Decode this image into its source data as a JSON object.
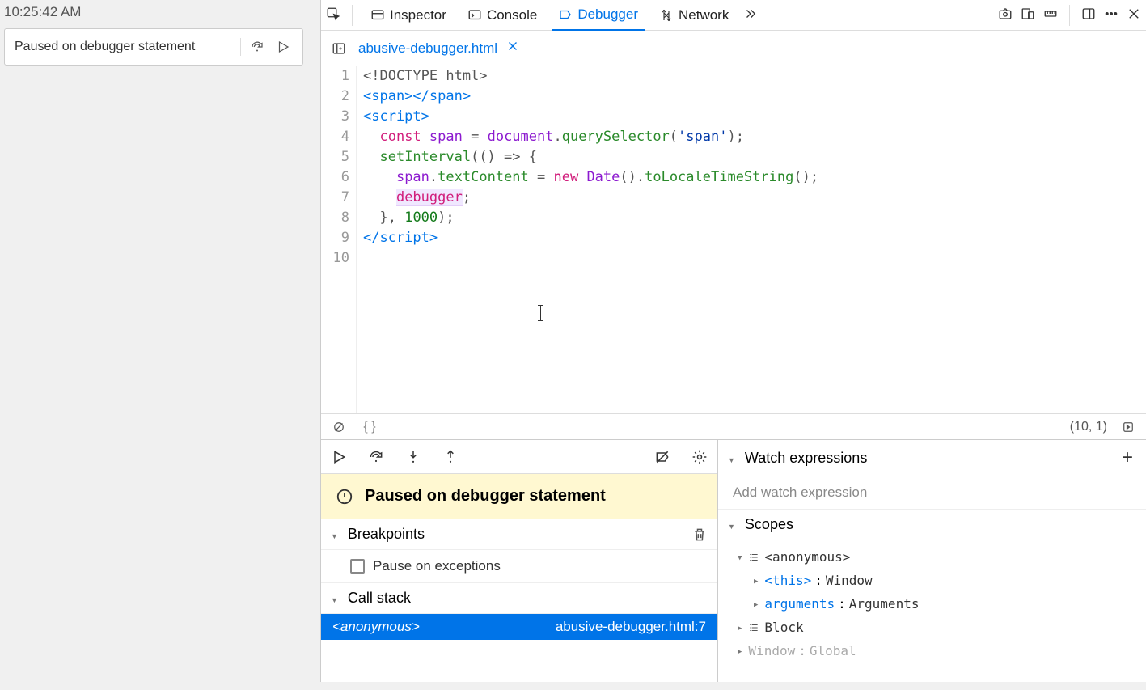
{
  "page": {
    "time": "10:25:42 AM"
  },
  "overlay": {
    "message": "Paused on debugger statement"
  },
  "toolbar": {
    "tabs": [
      {
        "label": "Inspector"
      },
      {
        "label": "Console"
      },
      {
        "label": "Debugger"
      },
      {
        "label": "Network"
      }
    ]
  },
  "file": {
    "name": "abusive-debugger.html"
  },
  "editor": {
    "lines": [
      "1",
      "2",
      "3",
      "4",
      "5",
      "6",
      "7",
      "8",
      "9",
      "10"
    ],
    "cursor": "(10, 1)"
  },
  "code": {
    "l1_doctype": "<!DOCTYPE html>",
    "l4_const": "const",
    "l4_span": "span",
    "l4_eq": " = ",
    "l4_doc": "document",
    "l4_qs": "querySelector",
    "l4_arg": "'span'",
    "l5_si": "setInterval",
    "l5_arrow": "(() => {",
    "l6_span": "span",
    "l6_tc": "textContent",
    "l6_eq": " = ",
    "l6_new": "new",
    "l6_date": "Date",
    "l6_lts": "toLocaleTimeString",
    "l7_dbg": "debugger",
    "l8_close": "}, ",
    "l8_num": "1000",
    "l8_end": ");"
  },
  "banner": {
    "text": "Paused on debugger statement"
  },
  "sections": {
    "breakpoints": "Breakpoints",
    "pauseOnExceptions": "Pause on exceptions",
    "callstack": "Call stack",
    "watch": "Watch expressions",
    "watchPlaceholder": "Add watch expression",
    "scopes": "Scopes"
  },
  "callstack": {
    "frame": "<anonymous>",
    "location": "abusive-debugger.html:7"
  },
  "scopes": {
    "anon": "<anonymous>",
    "this": "<this>",
    "thisVal": "Window",
    "args": "arguments",
    "argsVal": "Arguments",
    "block": "Block",
    "window": "Window",
    "global": "Global"
  }
}
